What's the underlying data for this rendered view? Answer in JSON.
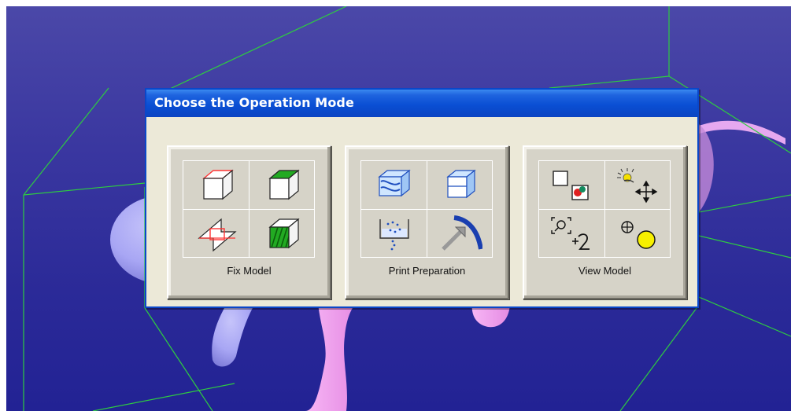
{
  "dialog": {
    "title": "Choose the Operation Mode"
  },
  "modes": [
    {
      "label": "Fix Model",
      "icons": [
        "box-red-edge-icon",
        "box-green-top-icon",
        "intersect-plane-icon",
        "box-green-striped-icon"
      ]
    },
    {
      "label": "Print Preparation",
      "icons": [
        "slice-layers-icon",
        "box-split-icon",
        "powder-bed-icon",
        "curve-arrow-icon"
      ]
    },
    {
      "label": "View Model",
      "icons": [
        "select-box-icon",
        "light-move-icon",
        "zoom-rotate-icon",
        "sphere-yellow-icon"
      ]
    }
  ],
  "colors": {
    "viewport_top": "#4b48a8",
    "viewport_bottom": "#222294",
    "titlebar": "#0a4fd4",
    "dialog_bg": "#ece9d8",
    "button_face": "#d6d3c8",
    "wireframe": "#2ecc40",
    "model_pink": "#f2a0f0",
    "model_lavender": "#a8a6f4"
  }
}
